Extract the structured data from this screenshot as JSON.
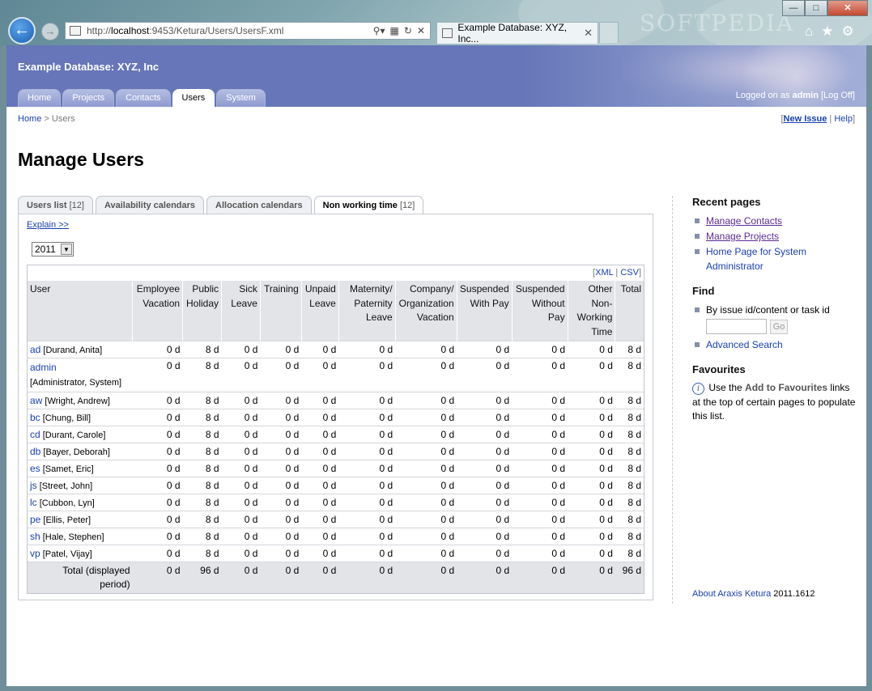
{
  "browser": {
    "url_prefix": "http://",
    "url_host": "localhost",
    "url_rest": ":9453/Ketura/Users/UsersF.xml",
    "tab_title": "Example Database: XYZ, Inc...",
    "watermark": "SOFTPEDIA"
  },
  "header": {
    "site_title": "Example Database: XYZ, Inc",
    "nav": [
      "Home",
      "Projects",
      "Contacts",
      "Users",
      "System"
    ],
    "active_nav": "Users",
    "login_prefix": "Logged on as",
    "login_user": "admin",
    "logoff": "[Log Off]"
  },
  "breadcrumb": {
    "home": "Home",
    "sep": ">",
    "current": "Users"
  },
  "toplinks": {
    "open": "[",
    "new_issue": "New Issue",
    "sep": "|",
    "help": "Help",
    "close": "]"
  },
  "page_title": "Manage Users",
  "tabs": [
    {
      "label": "Users list",
      "count": "[12]"
    },
    {
      "label": "Availability calendars",
      "count": ""
    },
    {
      "label": "Allocation calendars",
      "count": ""
    },
    {
      "label": "Non working time",
      "count": "[12]"
    }
  ],
  "active_tab": "Non working time",
  "panel": {
    "explain": "Explain >>",
    "year": "2011",
    "export_open": "[",
    "export_xml": "XML",
    "export_sep": "|",
    "export_csv": "CSV",
    "export_close": "]"
  },
  "table": {
    "headers": [
      "User",
      "Employee Vacation",
      "Public Holiday",
      "Sick Leave",
      "Training",
      "Unpaid Leave",
      "Maternity/ Paternity Leave",
      "Company/ Organization Vacation",
      "Suspended With Pay",
      "Suspended Without Pay",
      "Other Non-Working Time",
      "Total"
    ],
    "rows": [
      {
        "id": "ad",
        "name": "[Durand, Anita]",
        "values": [
          "0 d",
          "8 d",
          "0 d",
          "0 d",
          "0 d",
          "0 d",
          "0 d",
          "0 d",
          "0 d",
          "0 d",
          "8 d"
        ]
      },
      {
        "id": "admin",
        "name": "[Administrator, System]",
        "values": [
          "0 d",
          "8 d",
          "0 d",
          "0 d",
          "0 d",
          "0 d",
          "0 d",
          "0 d",
          "0 d",
          "0 d",
          "8 d"
        ]
      },
      {
        "id": "aw",
        "name": "[Wright, Andrew]",
        "values": [
          "0 d",
          "8 d",
          "0 d",
          "0 d",
          "0 d",
          "0 d",
          "0 d",
          "0 d",
          "0 d",
          "0 d",
          "8 d"
        ]
      },
      {
        "id": "bc",
        "name": "[Chung, Bill]",
        "values": [
          "0 d",
          "8 d",
          "0 d",
          "0 d",
          "0 d",
          "0 d",
          "0 d",
          "0 d",
          "0 d",
          "0 d",
          "8 d"
        ]
      },
      {
        "id": "cd",
        "name": "[Durant, Carole]",
        "values": [
          "0 d",
          "8 d",
          "0 d",
          "0 d",
          "0 d",
          "0 d",
          "0 d",
          "0 d",
          "0 d",
          "0 d",
          "8 d"
        ]
      },
      {
        "id": "db",
        "name": "[Bayer, Deborah]",
        "values": [
          "0 d",
          "8 d",
          "0 d",
          "0 d",
          "0 d",
          "0 d",
          "0 d",
          "0 d",
          "0 d",
          "0 d",
          "8 d"
        ]
      },
      {
        "id": "es",
        "name": "[Samet, Eric]",
        "values": [
          "0 d",
          "8 d",
          "0 d",
          "0 d",
          "0 d",
          "0 d",
          "0 d",
          "0 d",
          "0 d",
          "0 d",
          "8 d"
        ]
      },
      {
        "id": "js",
        "name": "[Street, John]",
        "values": [
          "0 d",
          "8 d",
          "0 d",
          "0 d",
          "0 d",
          "0 d",
          "0 d",
          "0 d",
          "0 d",
          "0 d",
          "8 d"
        ]
      },
      {
        "id": "lc",
        "name": "[Cubbon, Lyn]",
        "values": [
          "0 d",
          "8 d",
          "0 d",
          "0 d",
          "0 d",
          "0 d",
          "0 d",
          "0 d",
          "0 d",
          "0 d",
          "8 d"
        ]
      },
      {
        "id": "pe",
        "name": "[Ellis, Peter]",
        "values": [
          "0 d",
          "8 d",
          "0 d",
          "0 d",
          "0 d",
          "0 d",
          "0 d",
          "0 d",
          "0 d",
          "0 d",
          "8 d"
        ]
      },
      {
        "id": "sh",
        "name": "[Hale, Stephen]",
        "values": [
          "0 d",
          "8 d",
          "0 d",
          "0 d",
          "0 d",
          "0 d",
          "0 d",
          "0 d",
          "0 d",
          "0 d",
          "8 d"
        ]
      },
      {
        "id": "vp",
        "name": "[Patel, Vijay]",
        "values": [
          "0 d",
          "8 d",
          "0 d",
          "0 d",
          "0 d",
          "0 d",
          "0 d",
          "0 d",
          "0 d",
          "0 d",
          "8 d"
        ]
      }
    ],
    "total_label": "Total (displayed period)",
    "totals": [
      "0 d",
      "96 d",
      "0 d",
      "0 d",
      "0 d",
      "0 d",
      "0 d",
      "0 d",
      "0 d",
      "0 d",
      "96 d"
    ]
  },
  "sidebar": {
    "recent_title": "Recent pages",
    "recent": [
      "Manage Contacts",
      "Manage Projects",
      "Home Page for System Administrator"
    ],
    "find_title": "Find",
    "find_item": "By issue id/content or task id",
    "go": "Go",
    "advanced": "Advanced Search",
    "fav_title": "Favourites",
    "fav_pre": "Use the",
    "fav_link": "Add to Favourites",
    "fav_post": "links at the top of certain pages to populate this list.",
    "about_link": "About Araxis Ketura",
    "version": "2011.1612"
  },
  "colors": {
    "banner": "#6676b8",
    "link": "#1a3fb0",
    "visited": "#5b2c93",
    "header_bg": "#e2e4e8"
  }
}
